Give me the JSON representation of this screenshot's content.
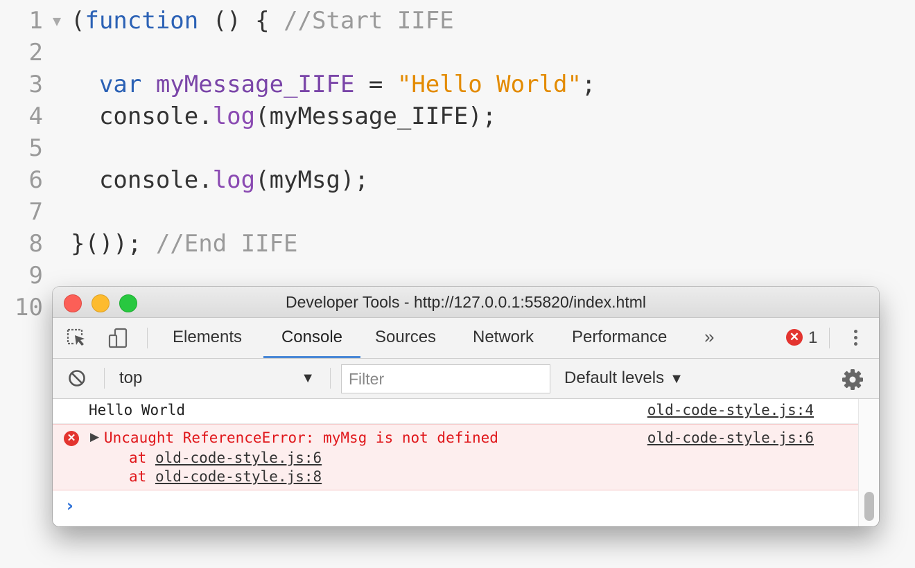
{
  "editor": {
    "lines": [
      {
        "n": "1",
        "fold": true,
        "tokens": [
          {
            "t": "plain",
            "v": "("
          },
          {
            "t": "kw",
            "v": "function"
          },
          {
            "t": "plain",
            "v": " () { "
          },
          {
            "t": "com",
            "v": "//Start IIFE"
          }
        ]
      },
      {
        "n": "2",
        "tokens": []
      },
      {
        "n": "3",
        "tokens": [
          {
            "t": "plain",
            "v": "  "
          },
          {
            "t": "kw",
            "v": "var"
          },
          {
            "t": "plain",
            "v": " "
          },
          {
            "t": "var",
            "v": "myMessage_IIFE"
          },
          {
            "t": "plain",
            "v": " = "
          },
          {
            "t": "str",
            "v": "\"Hello World\""
          },
          {
            "t": "plain",
            "v": ";"
          }
        ]
      },
      {
        "n": "4",
        "tokens": [
          {
            "t": "plain",
            "v": "  console."
          },
          {
            "t": "fn",
            "v": "log"
          },
          {
            "t": "plain",
            "v": "(myMessage_IIFE);"
          }
        ]
      },
      {
        "n": "5",
        "tokens": []
      },
      {
        "n": "6",
        "tokens": [
          {
            "t": "plain",
            "v": "  console."
          },
          {
            "t": "fn",
            "v": "log"
          },
          {
            "t": "plain",
            "v": "(myMsg);"
          }
        ]
      },
      {
        "n": "7",
        "tokens": []
      },
      {
        "n": "8",
        "tokens": [
          {
            "t": "plain",
            "v": "}()); "
          },
          {
            "t": "com",
            "v": "//End IIFE"
          }
        ]
      },
      {
        "n": "9",
        "tokens": []
      },
      {
        "n": "10",
        "tokens": []
      }
    ]
  },
  "devtools": {
    "window_title": "Developer Tools - http://127.0.0.1:55820/index.html",
    "tabs": [
      "Elements",
      "Console",
      "Sources",
      "Network",
      "Performance"
    ],
    "active_tab": "Console",
    "more_tabs": "»",
    "error_count": "1",
    "toolbar": {
      "context": "top",
      "filter_placeholder": "Filter",
      "levels": "Default levels"
    },
    "console": {
      "log_message": "Hello World",
      "log_source": "old-code-style.js:4",
      "error_message": "Uncaught ReferenceError: myMsg is not defined",
      "error_source": "old-code-style.js:6",
      "stack": [
        {
          "prefix": "at ",
          "link": "old-code-style.js:6"
        },
        {
          "prefix": "at ",
          "link": "old-code-style.js:8"
        }
      ],
      "prompt": "›"
    }
  }
}
